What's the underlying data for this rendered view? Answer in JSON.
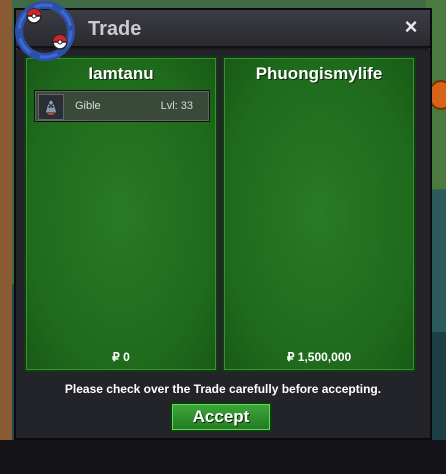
{
  "window": {
    "title": "Trade",
    "close_symbol": "×"
  },
  "left_panel": {
    "player_name": "Iamtanu",
    "pokemon": [
      {
        "name": "Gible",
        "level": "Lvl: 33",
        "icon": "gible-icon"
      }
    ],
    "money": "₽ 0"
  },
  "right_panel": {
    "player_name": "Phuongismylife",
    "pokemon": [],
    "money": "₽ 1,500,000"
  },
  "footer": {
    "notice": "Please check over the Trade carefully before accepting.",
    "accept_label": "Accept"
  },
  "colors": {
    "panel_green": "#1f6a1c",
    "accept_green": "#2f962c",
    "window_dark": "#23232a"
  }
}
